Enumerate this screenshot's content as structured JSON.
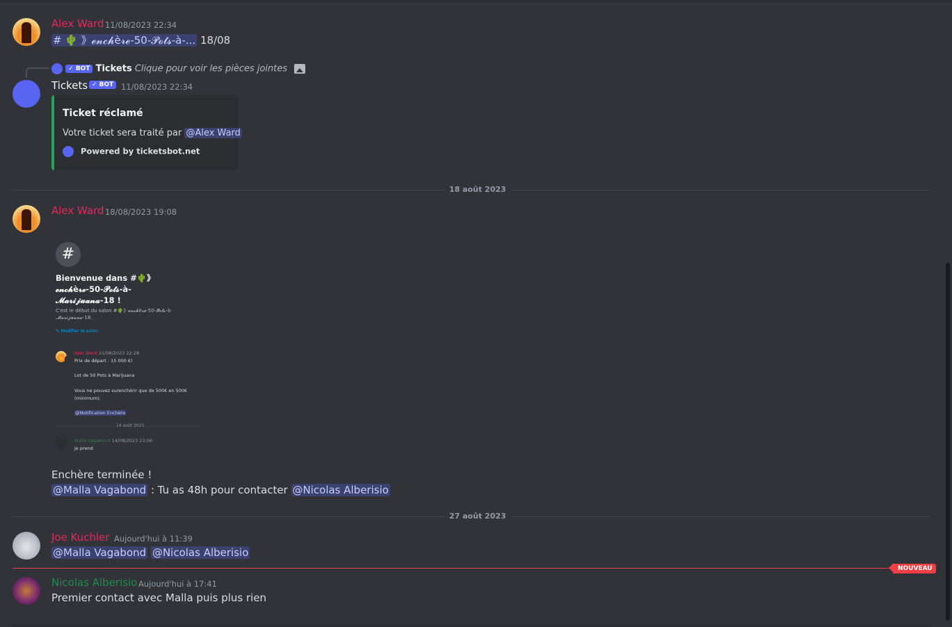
{
  "messages": [
    {
      "author": "Alex Ward",
      "timestamp": "11/08/2023 22:34",
      "channel_pill": "# 🌵 》𝓮𝓷𝓬𝓱è𝓻𝓮-50-𝓟𝓸𝓽𝓼-à-...",
      "text_after": "18/08"
    },
    {
      "author": "Tickets",
      "bot_tag": "✓ BOT",
      "timestamp": "11/08/2023 22:34",
      "reply": {
        "author": "Tickets",
        "bot_tag": "✓ BOT",
        "text": "Clique pour voir les pièces jointes"
      },
      "embed": {
        "title": "Ticket réclamé",
        "description": "Votre ticket sera traité par",
        "mention": "@Alex Ward",
        "footer": "Powered by ticketsbot.net",
        "color": "#23a559"
      }
    },
    {
      "author": "Alex Ward",
      "timestamp": "18/08/2023 19:08",
      "screenshot": {
        "hash": "#",
        "title": "Bienvenue dans #🌵》\n𝓮𝓷𝓬𝓱è𝓻𝓮-50-𝓟𝓸𝓽𝓼-à-\n𝓜𝓪𝓻𝓲𝓳𝓾𝓪𝓷𝓪-18 !",
        "subtitle": "C'est le début du salon #🌵》𝓮𝓷𝓬𝓱è𝓻𝓮-50-𝓟𝓸𝓽𝓼-à-\n𝓜𝓪𝓻𝓲𝓳𝓾𝓪𝓷𝓪-18.",
        "edit_link": "✎ Modifier le salon",
        "msg1_author": "Alex Ward",
        "msg1_time": "11/08/2023 22:28",
        "msg1_line1": "Prix de départ : 15 000 €!",
        "msg1_line2": "Lot de 50 Pots à Marijuana",
        "msg1_line3": "Vous ne pouvez surenchérir que de 500€ en 500€",
        "msg1_line4": "(minimum).",
        "msg1_mention": "@Notification Enchère",
        "divider": "14 août 2023",
        "msg2_author": "Malla Vagabond",
        "msg2_time": "14/08/2023 23:06",
        "msg2_text": "je prend"
      },
      "line1": "Enchère terminée !",
      "line2_mention1": "@Malla Vagabond",
      "line2_text": " : Tu as 48h pour contacter ",
      "line2_mention2": "@Nicolas Alberisio"
    },
    {
      "author": "Joe Kuchler",
      "timestamp": "Aujourd'hui à 11:39",
      "mention1": "@Malla Vagabond",
      "mention2": "@Nicolas Alberisio"
    },
    {
      "author": "Nicolas Alberisio",
      "timestamp": "Aujourd'hui à 17:41",
      "text": "Premier contact avec Malla puis plus rien"
    }
  ],
  "dividers": {
    "first": "18 août 2023",
    "second": "27 août 2023"
  },
  "new_badge": "NOUVEAU",
  "colors": {
    "background": "#313338",
    "name_red": "#e3295e",
    "name_green": "#1f8b4c",
    "mention_bg": "#3c4270",
    "bot_tag": "#5865f2",
    "new_line": "#f23f43"
  }
}
